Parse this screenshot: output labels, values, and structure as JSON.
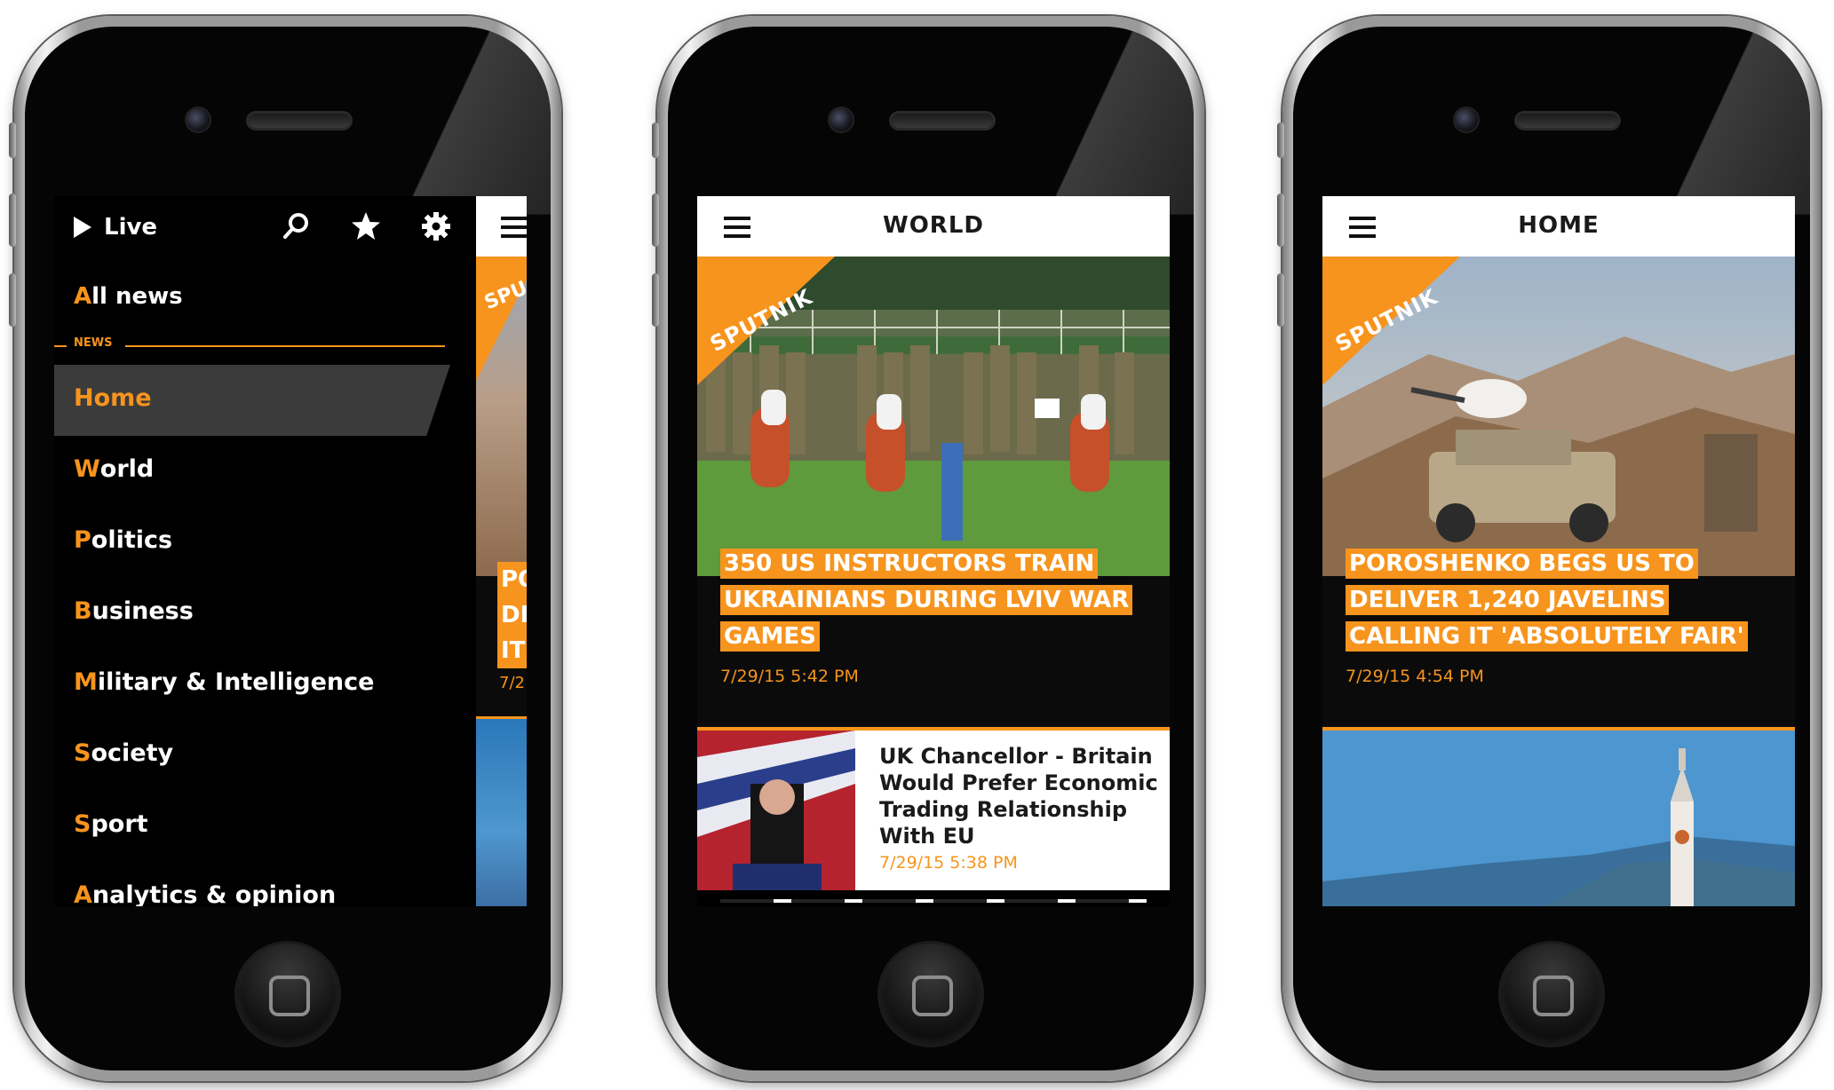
{
  "menu_screen": {
    "live_label": "Live",
    "all_news": {
      "first": "A",
      "rest": "ll news"
    },
    "section_label": "NEWS",
    "items": [
      {
        "first": "",
        "rest": "Home",
        "active": true
      },
      {
        "first": "W",
        "rest": "orld"
      },
      {
        "first": "P",
        "rest": "olitics"
      },
      {
        "first": "B",
        "rest": "usiness"
      },
      {
        "first": "M",
        "rest": "ilitary & Intelligence"
      },
      {
        "first": "S",
        "rest": "ociety"
      },
      {
        "first": "S",
        "rest": "port"
      },
      {
        "first": "A",
        "rest": "nalytics & opinion"
      }
    ],
    "peek": {
      "badge": "SPU",
      "headline": "PO\nDE\nIT",
      "date": "7/2"
    }
  },
  "world_screen": {
    "title": "WORLD",
    "badge": "SPUTNIK",
    "hero_headline": "350 US INSTRUCTORS TRAIN UKRAINIANS DURING LVIV WAR GAMES",
    "hero_date": "7/29/15 5:42 PM",
    "list_title": "UK Chancellor - Britain\nWould Prefer Economic\nTrading Relationship\nWith EU",
    "list_date": "7/29/15 5:38 PM"
  },
  "home_screen": {
    "title": "HOME",
    "badge": "SPUTNIK",
    "hero_headline": "POROSHENKO BEGS US TO DELIVER 1,240 JAVELINS CALLING IT 'ABSOLUTELY FAIR'",
    "hero_date": "7/29/15 4:54 PM"
  },
  "colors": {
    "accent": "#f7941d",
    "menu_bg": "#000000",
    "active_bg": "#3b3b3b"
  },
  "icons": [
    "play-icon",
    "search-icon",
    "star-icon",
    "gear-icon",
    "hamburger-icon",
    "home-button"
  ]
}
